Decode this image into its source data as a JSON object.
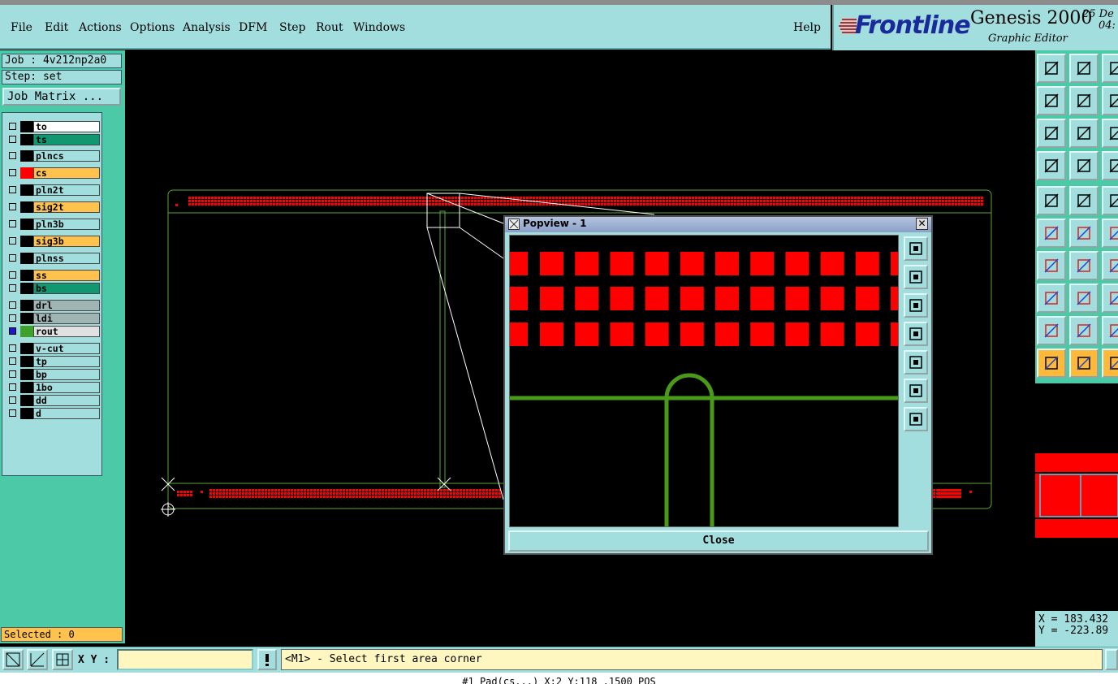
{
  "menu": {
    "file": "File",
    "edit": "Edit",
    "actions": "Actions",
    "options": "Options",
    "analysis": "Analysis",
    "dfm": "DFM",
    "step": "Step",
    "rout": "Rout",
    "windows": "Windows",
    "help": "Help"
  },
  "brand": {
    "logo": "Frontline",
    "product": "Genesis 2000",
    "subtitle": "Graphic Editor",
    "date_line1": "25 De",
    "date_line2": "04:"
  },
  "job": {
    "job_line": "Job : 4v212np2a0",
    "step_line": "Step: set",
    "matrix_button": "Job Matrix ..."
  },
  "layers": [
    {
      "name": "to",
      "bg": "#ffffff",
      "swatch": "#000000"
    },
    {
      "name": "ts",
      "bg": "#129870",
      "swatch": "#000000"
    },
    {
      "name": "plncs",
      "bg": "#a3dede",
      "swatch": "#000000"
    },
    {
      "name": "cs",
      "bg": "#ffc34d",
      "swatch": "#ff0000"
    },
    {
      "name": "pln2t",
      "bg": "#a3dede",
      "swatch": "#000000"
    },
    {
      "name": "sig2t",
      "bg": "#ffc34d",
      "swatch": "#000000"
    },
    {
      "name": "pln3b",
      "bg": "#a3dede",
      "swatch": "#000000"
    },
    {
      "name": "sig3b",
      "bg": "#ffc34d",
      "swatch": "#000000"
    },
    {
      "name": "plnss",
      "bg": "#a3dede",
      "swatch": "#000000"
    },
    {
      "name": "ss",
      "bg": "#ffc34d",
      "swatch": "#000000"
    },
    {
      "name": "bs",
      "bg": "#129870",
      "swatch": "#000000"
    },
    {
      "name": "drl",
      "bg": "#a0b4b4",
      "swatch": "#000000"
    },
    {
      "name": "ldi",
      "bg": "#a0b4b4",
      "swatch": "#000000"
    },
    {
      "name": "rout",
      "bg": "#e0e0e0",
      "swatch": "#3fa12a"
    },
    {
      "name": "v-cut",
      "bg": "#a3dede",
      "swatch": "#000000"
    },
    {
      "name": "tp",
      "bg": "#a3dede",
      "swatch": "#000000"
    },
    {
      "name": "bp",
      "bg": "#a3dede",
      "swatch": "#000000"
    },
    {
      "name": "1bo",
      "bg": "#a3dede",
      "swatch": "#000000"
    },
    {
      "name": "dd",
      "bg": "#a3dede",
      "swatch": "#000000"
    },
    {
      "name": "d",
      "bg": "#a3dede",
      "swatch": "#000000"
    }
  ],
  "selected": "Selected : 0",
  "coords": {
    "x": "X = 183.432",
    "y": "Y = -223.89"
  },
  "bottom": {
    "xy_label": "X Y :",
    "xy_value": "",
    "message": "<M1> - Select first area corner",
    "status": "#1 Pad(cs...) X:2 Y:118 .1500 POS"
  },
  "popview": {
    "title": "Popview - 1",
    "close_label": "Close"
  },
  "colors": {
    "pad": "#ff0000",
    "rout": "#4a9a1a",
    "outline": "#5aa53a"
  }
}
